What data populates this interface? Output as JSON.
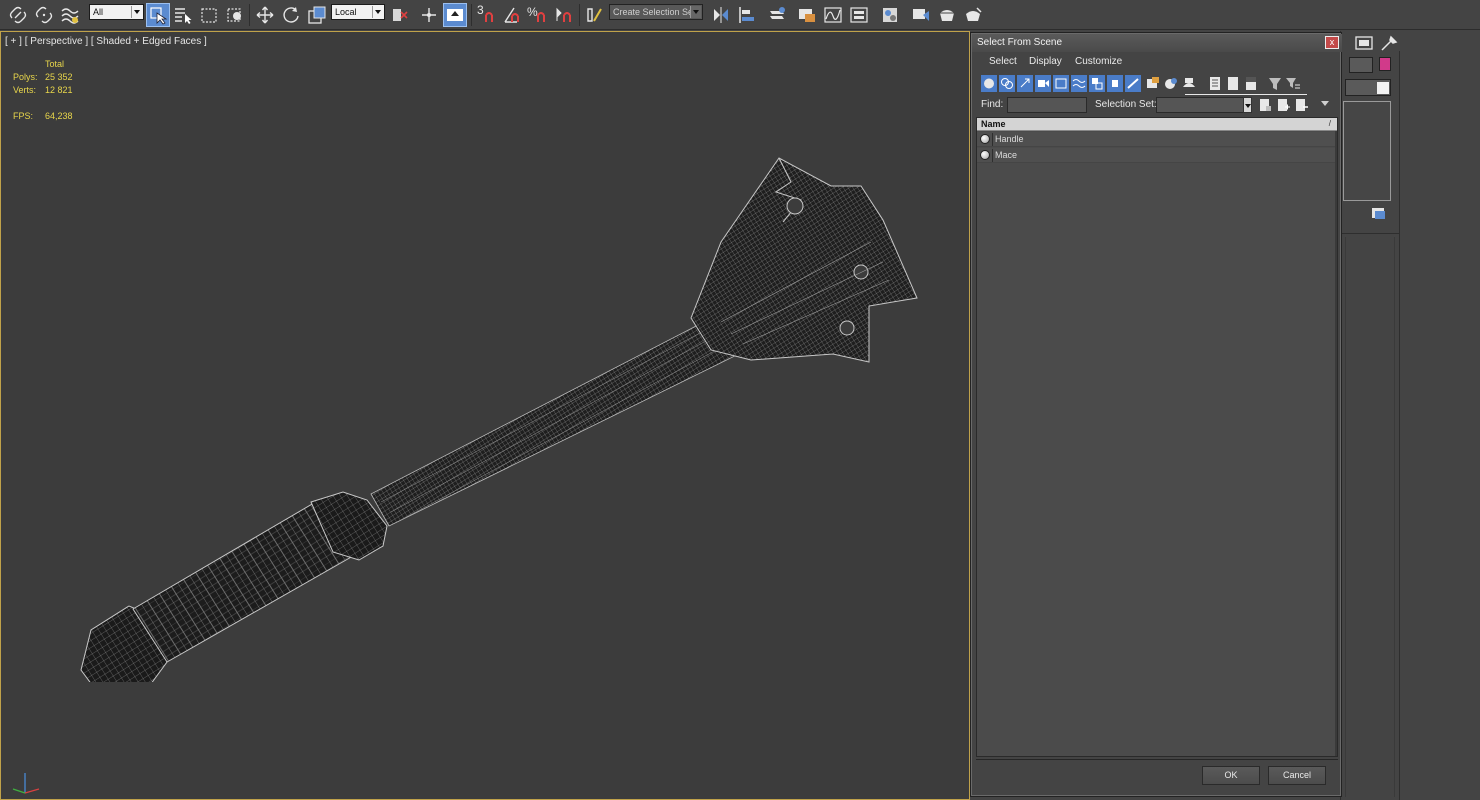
{
  "toolbar": {
    "selection_filter": "All",
    "coordinate_system": "Local",
    "snap_label": "3",
    "percent_snap_label": "%",
    "named_selection_set": "Create Selection Se"
  },
  "viewport": {
    "label": "[ + ] [ Perspective ] [ Shaded + Edged Faces ]",
    "stats": {
      "total_label": "Total",
      "polys_label": "Polys:",
      "polys_value": "25 352",
      "verts_label": "Verts:",
      "verts_value": "12 821",
      "fps_label": "FPS:",
      "fps_value": "64,238"
    },
    "accent_color": "#e8d64b"
  },
  "dialog": {
    "title": "Select From Scene",
    "close_glyph": "x",
    "menu": [
      "Select",
      "Display",
      "Customize"
    ],
    "find_label": "Find:",
    "find_value": "",
    "selection_set_label": "Selection Set:",
    "selection_set_value": "",
    "list_header": "Name",
    "sort_glyph": "/",
    "items": [
      {
        "label": "Handle"
      },
      {
        "label": "Mace"
      }
    ],
    "ok_label": "OK",
    "cancel_label": "Cancel"
  },
  "command_panel": {
    "object_color": "#d13a8a"
  }
}
